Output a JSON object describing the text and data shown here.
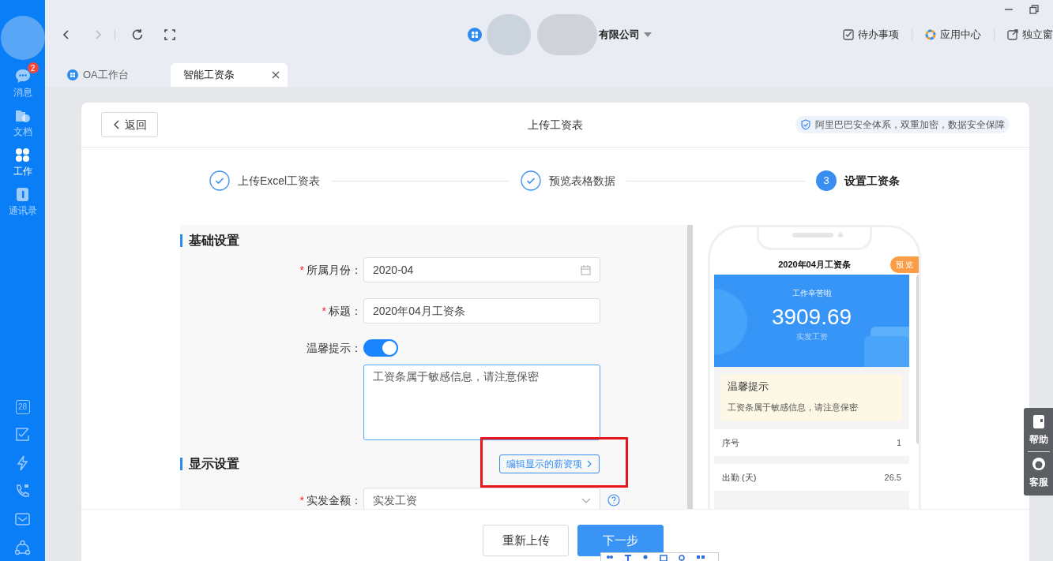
{
  "sidebar": {
    "items": [
      {
        "kind": "chat",
        "label": "消息",
        "badge": "2",
        "selected": false
      },
      {
        "kind": "folder",
        "label": "文档",
        "selected": false
      },
      {
        "kind": "apps",
        "label": "工作",
        "selected": true
      },
      {
        "kind": "contacts",
        "label": "通讯录",
        "selected": false
      }
    ],
    "tools": [
      {
        "kind": "calendar",
        "text": "28"
      },
      {
        "kind": "todo"
      },
      {
        "kind": "flash"
      },
      {
        "kind": "call"
      },
      {
        "kind": "mail"
      },
      {
        "kind": "network"
      }
    ]
  },
  "topbar": {
    "company": "有限公司",
    "actions": [
      {
        "kind": "todo",
        "label": "待办事项"
      },
      {
        "kind": "apps",
        "label": "应用中心"
      },
      {
        "kind": "window",
        "label": "独立窗"
      }
    ]
  },
  "tabs": [
    {
      "label": "OA工作台",
      "selected": false
    },
    {
      "label": "智能工资条",
      "selected": true
    }
  ],
  "card": {
    "back": "返回",
    "title": "上传工资表",
    "security": "阿里巴巴安全体系，双重加密，数据安全保障"
  },
  "steps": [
    {
      "label": "上传Excel工资表",
      "done": true,
      "selected": false
    },
    {
      "label": "预览表格数据",
      "done": true,
      "selected": false
    },
    {
      "number": "3",
      "label": "设置工资条",
      "done": false,
      "selected": true
    }
  ],
  "form": {
    "basic_title": "基础设置",
    "month": {
      "required_mark": "*",
      "label": "所属月份：",
      "value": "2020-04"
    },
    "title": {
      "required_mark": "*",
      "label": "标题：",
      "value": "2020年04月工资条"
    },
    "tip": {
      "label": "温馨提示：",
      "on": true,
      "text": "工资条属于敏感信息，请注意保密"
    },
    "display_title": "显示设置",
    "edit_link": "编辑显示的薪资项",
    "amount": {
      "required_mark": "*",
      "label": "实发金额：",
      "value": "实发工资"
    }
  },
  "preview": {
    "title": "2020年04月工资条",
    "badge": "预 览",
    "greeting": "工作辛苦啦",
    "amount": "3909.69",
    "amount_label": "实发工资",
    "tip_title": "温馨提示",
    "tip_text": "工资条属于敏感信息，请注意保密",
    "rows": [
      {
        "label": "序号",
        "value": "1"
      },
      {
        "label": "出勤 (天)",
        "value": "26.5"
      }
    ]
  },
  "footer": {
    "buttons": [
      {
        "kind": "secondary",
        "label": "重新上传"
      },
      {
        "kind": "primary",
        "label": "下一步"
      }
    ]
  },
  "help": [
    {
      "kind": "book",
      "label": "帮助"
    },
    {
      "kind": "service",
      "label": "客服"
    }
  ]
}
